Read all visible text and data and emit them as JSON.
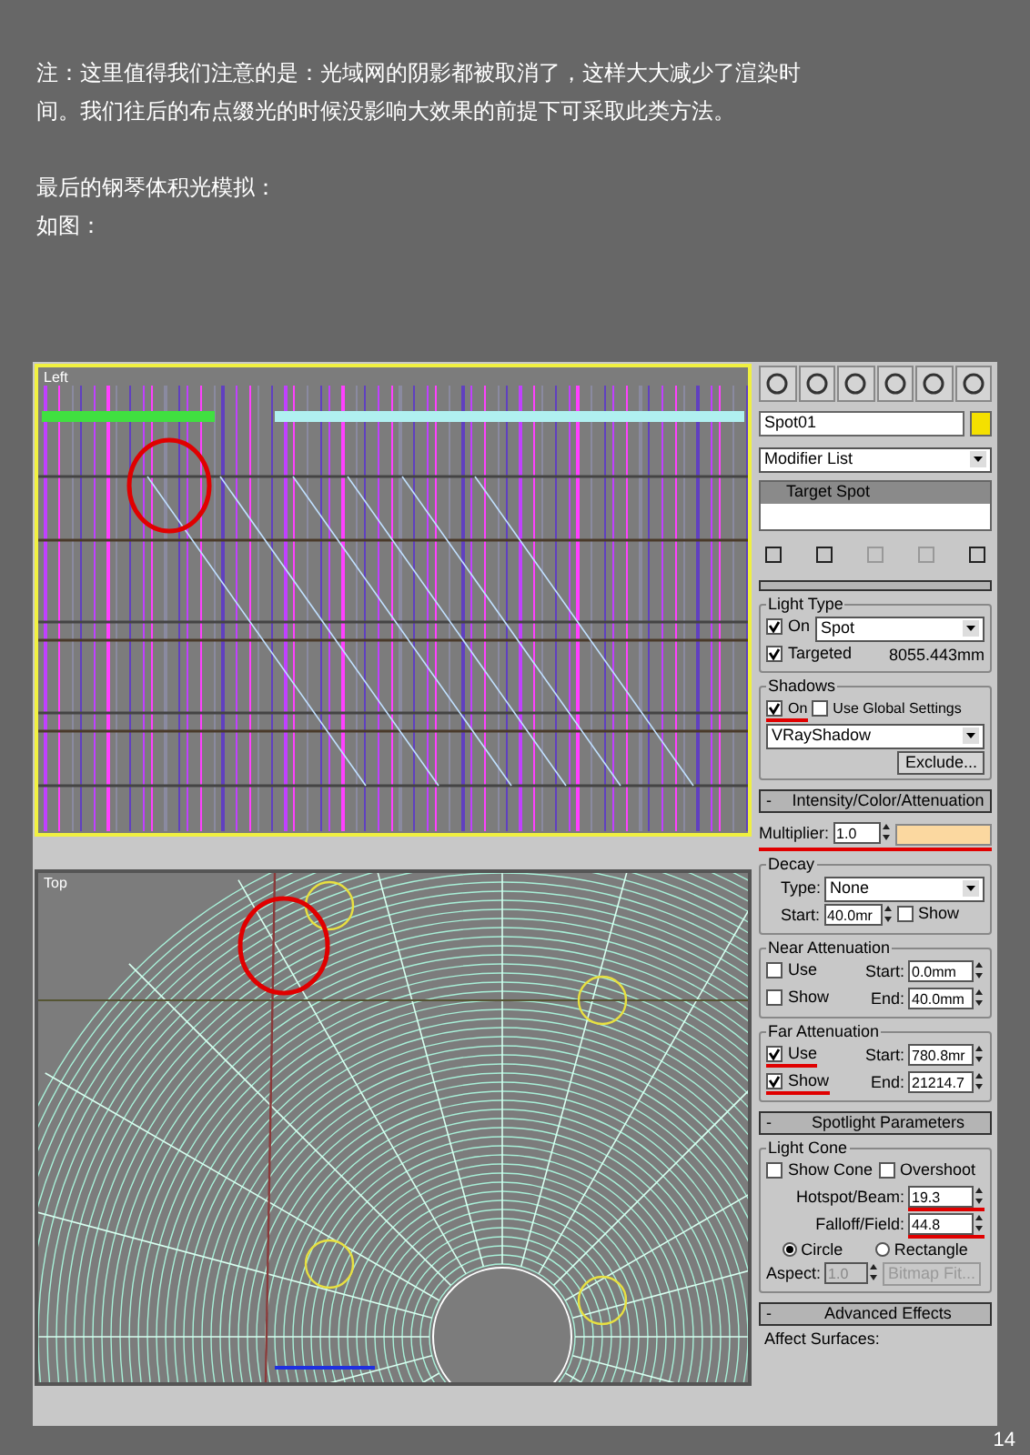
{
  "note": {
    "paragraphs": [
      "注：这里值得我们注意的是：光域网的阴影都被取消了，这样大大减少了渲染时间。我们往后的布点缀光的时候没影响大效果的前提下可采取此类方法。",
      "最后的钢琴体积光模拟：",
      "如图："
    ]
  },
  "viewports": [
    {
      "label": "Left",
      "active": true
    },
    {
      "label": "Top",
      "active": false
    }
  ],
  "command_panel": {
    "object_name": "Spot01",
    "modifier_list": "Modifier List",
    "stack_item": "Target Spot",
    "light_type": {
      "title": "Light Type",
      "on": {
        "label": "On",
        "checked": true
      },
      "type": "Spot",
      "targeted": {
        "label": "Targeted",
        "checked": true
      },
      "distance": "8055.443mm"
    },
    "shadows": {
      "title": "Shadows",
      "on": {
        "label": "On",
        "checked": true,
        "highlighted": true
      },
      "use_global": {
        "label": "Use Global Settings",
        "checked": false
      },
      "type": "VRayShadow",
      "exclude": "Exclude..."
    },
    "intensity": {
      "title": "Intensity/Color/Attenuation",
      "sign": "-",
      "multiplier_label": "Multiplier:",
      "multiplier": "1.0",
      "highlighted": true,
      "decay": {
        "title": "Decay",
        "type_label": "Type:",
        "type": "None",
        "start_label": "Start:",
        "start": "40.0mr",
        "show": {
          "label": "Show",
          "checked": false
        }
      },
      "near": {
        "title": "Near Attenuation",
        "use": {
          "label": "Use",
          "checked": false,
          "highlighted": false
        },
        "start_label": "Start:",
        "start": "0.0mm",
        "show": {
          "label": "Show",
          "checked": false,
          "highlighted": false
        },
        "end_label": "End:",
        "end": "40.0mm"
      },
      "far": {
        "title": "Far Attenuation",
        "use": {
          "label": "Use",
          "checked": true,
          "highlighted": true
        },
        "start_label": "Start:",
        "start": "780.8mr",
        "show": {
          "label": "Show",
          "checked": true,
          "highlighted": true
        },
        "end_label": "End:",
        "end": "21214.7"
      }
    },
    "spotlight": {
      "title": "Spotlight Parameters",
      "sign": "-",
      "cone_title": "Light Cone",
      "show_cone": {
        "label": "Show Cone",
        "checked": false
      },
      "overshoot": {
        "label": "Overshoot",
        "checked": false
      },
      "hotspot_label": "Hotspot/Beam:",
      "hotspot": "19.3",
      "hotspot_highlighted": true,
      "falloff_label": "Falloff/Field:",
      "falloff": "44.8",
      "falloff_highlighted": true,
      "shapes": [
        {
          "label": "Circle",
          "selected": true
        },
        {
          "label": "Rectangle",
          "selected": false
        }
      ],
      "aspect_label": "Aspect:",
      "aspect": "1.0",
      "aspect_disabled": true,
      "bitmap_fit": "Bitmap Fit...",
      "bitmap_fit_disabled": true
    },
    "advanced": {
      "title": "Advanced Effects",
      "sign": "-",
      "affect_label": "Affect Surfaces:"
    }
  },
  "page_number": "14"
}
